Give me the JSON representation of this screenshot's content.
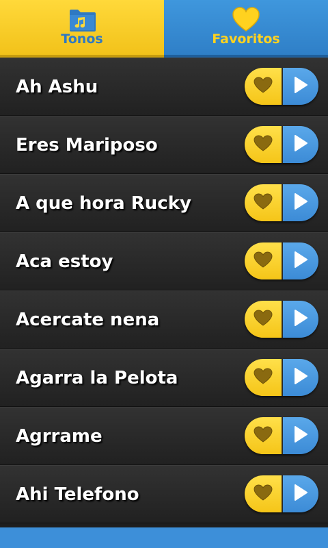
{
  "tabs": [
    {
      "label": "Tonos",
      "icon": "music-folder-icon"
    },
    {
      "label": "Favoritos",
      "icon": "heart-icon"
    }
  ],
  "songs": [
    {
      "title": "Ah Ashu"
    },
    {
      "title": "Eres Mariposo"
    },
    {
      "title": "A que hora Rucky"
    },
    {
      "title": "Aca estoy"
    },
    {
      "title": "Acercate nena"
    },
    {
      "title": "Agarra la Pelota"
    },
    {
      "title": "Agrrame"
    },
    {
      "title": "Ahi Telefono"
    }
  ],
  "colors": {
    "accent_yellow": "#f5c518",
    "accent_blue": "#3c8bd6",
    "row_bg": "#2a2a2a"
  }
}
